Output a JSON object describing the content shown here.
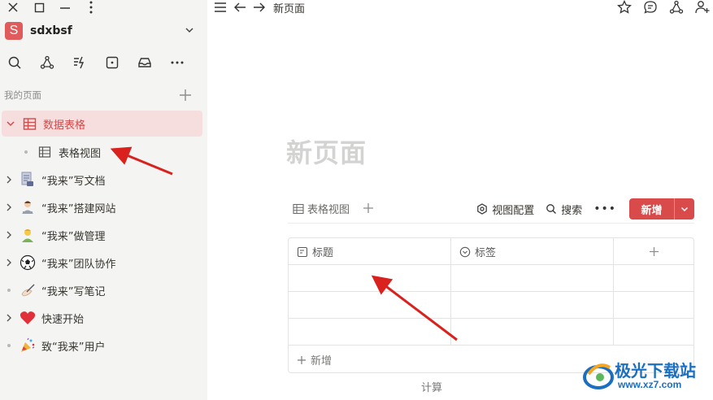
{
  "window": {
    "controls": [
      "close-icon",
      "maximize-icon",
      "minimize-icon",
      "more-vertical-icon"
    ]
  },
  "workspace": {
    "avatar_letter": "S",
    "name": "sdxbsf",
    "accent": "#e05c5c"
  },
  "toolbar": {
    "icons": [
      "search-icon",
      "graph-icon",
      "quick-action-icon",
      "square-dot-icon",
      "inbox-icon",
      "more-icon"
    ]
  },
  "sidebar": {
    "section_label": "我的页面",
    "items": [
      {
        "label": "数据表格",
        "icon": "table-icon",
        "active": true,
        "caret": "down"
      },
      {
        "label": "表格视图",
        "icon": "grid-view-icon",
        "child": true
      },
      {
        "label": "“我来”写文档",
        "icon": "document-emoji",
        "caret": "right"
      },
      {
        "label": "“我来”搭建网站",
        "icon": "person-at-desk-emoji",
        "caret": "right"
      },
      {
        "label": "“我来”做管理",
        "icon": "manager-emoji",
        "caret": "right"
      },
      {
        "label": "“我来”团队协作",
        "icon": "soccer-ball-emoji",
        "caret": "right"
      },
      {
        "label": "“我来”写笔记",
        "icon": "writing-hand-emoji",
        "caret": "none"
      },
      {
        "label": "快速开始",
        "icon": "heart-emoji",
        "caret": "right"
      },
      {
        "label": "致“我来”用户",
        "icon": "party-popper-emoji",
        "caret": "none"
      }
    ]
  },
  "topbar": {
    "breadcrumb": "新页面",
    "right_icons": [
      "star-icon",
      "comment-icon",
      "share-graph-icon",
      "add-user-icon"
    ]
  },
  "page": {
    "title": "新页面",
    "view_tab": "表格视图",
    "view_config": "视图配置",
    "search": "搜索",
    "new_button": "新增",
    "columns": [
      "标题",
      "标签"
    ],
    "empty_rows": 3,
    "add_row": "新增",
    "calc": "计算"
  },
  "watermark": {
    "text": "极光下载站",
    "url": "www.xz7.com"
  },
  "colors": {
    "accent": "#d94a4a",
    "active_bg": "#f6dede",
    "sidebar_bg": "#f4f4f3"
  }
}
